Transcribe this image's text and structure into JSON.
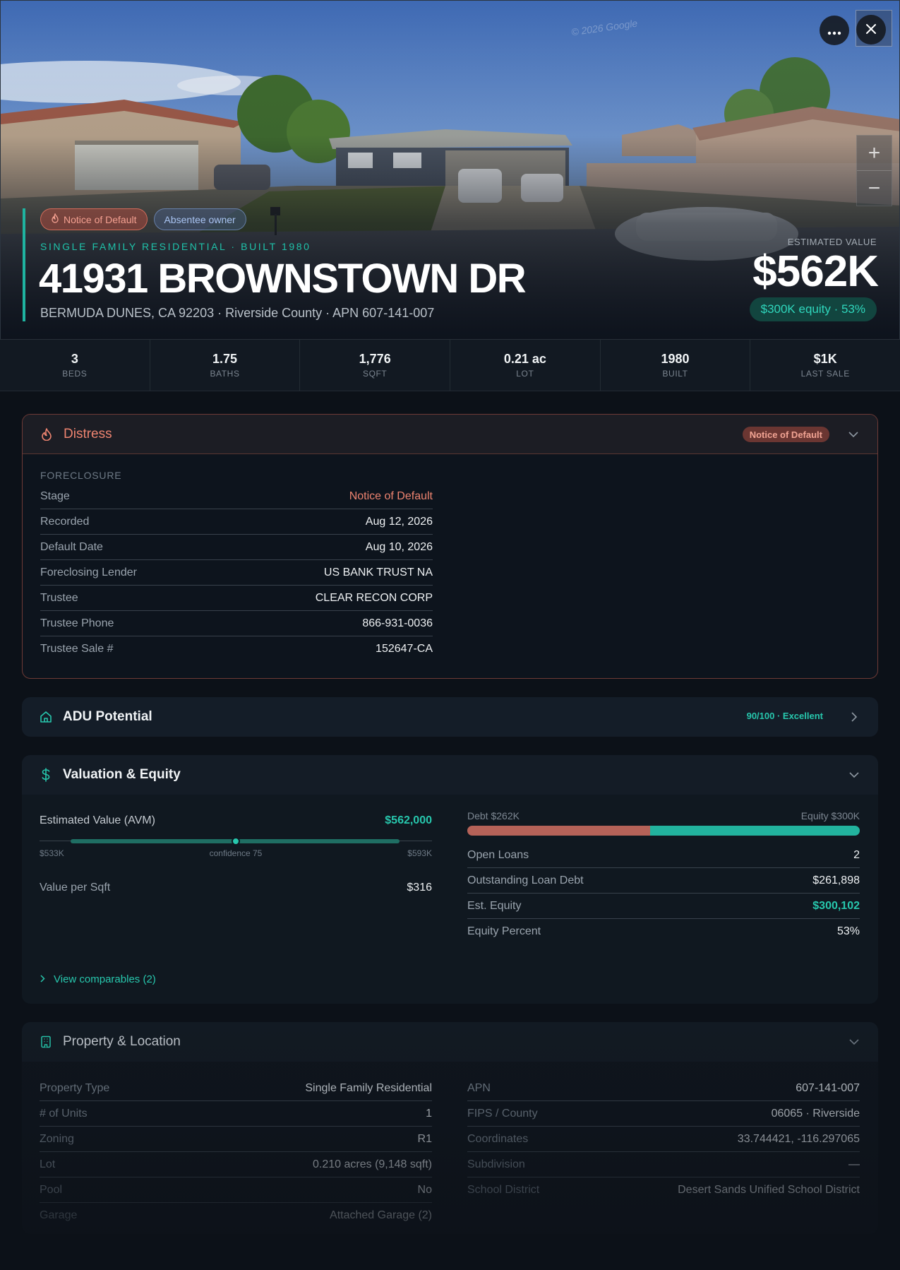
{
  "hero": {
    "watermark": "© 2026 Google",
    "chips": [
      "Notice of Default",
      "Absentee owner"
    ],
    "eyebrow": "SINGLE FAMILY RESIDENTIAL · BUILT 1980",
    "address": "41931 BROWNSTOWN DR",
    "subaddress": "BERMUDA DUNES, CA 92203 · Riverside County · APN 607-141-007",
    "estimated_label": "ESTIMATED VALUE",
    "estimated_value": "$562K",
    "equity_pill": "$300K equity · 53%",
    "zoom_in": "+",
    "zoom_out": "−"
  },
  "stats": [
    {
      "value": "3",
      "label": "BEDS"
    },
    {
      "value": "1.75",
      "label": "BATHS"
    },
    {
      "value": "1,776",
      "label": "SQFT"
    },
    {
      "value": "0.21 ac",
      "label": "LOT"
    },
    {
      "value": "1980",
      "label": "BUILT"
    },
    {
      "value": "$1K",
      "label": "LAST SALE"
    }
  ],
  "distress": {
    "title": "Distress",
    "badge": "Notice of Default",
    "section": "FORECLOSURE",
    "rows": [
      {
        "k": "Stage",
        "v": "Notice of Default"
      },
      {
        "k": "Recorded",
        "v": "Aug 12, 2026"
      },
      {
        "k": "Default Date",
        "v": "Aug 10, 2026"
      },
      {
        "k": "Foreclosing Lender",
        "v": "US BANK TRUST NA"
      },
      {
        "k": "Trustee",
        "v": "CLEAR RECON CORP"
      },
      {
        "k": "Trustee Phone",
        "v": "866-931-0036"
      },
      {
        "k": "Trustee Sale #",
        "v": "152647-CA"
      }
    ]
  },
  "adu": {
    "title": "ADU Potential",
    "score": "90/100 · Excellent"
  },
  "valuation": {
    "title": "Valuation & Equity",
    "avm_label": "Estimated Value (AVM)",
    "avm_value": "$562,000",
    "range_low": "$533K",
    "range_mid": "confidence 75",
    "range_high": "$593K",
    "confidence": 75,
    "value_per_sqft_label": "Value per Sqft",
    "value_per_sqft": "$316",
    "debt_label": "Debt $262K",
    "equity_label": "Equity $300K",
    "debt_share": 0.466,
    "rows": [
      {
        "k": "Open Loans",
        "v": "2"
      },
      {
        "k": "Outstanding Loan Debt",
        "v": "$261,898"
      },
      {
        "k": "Est. Equity",
        "v": "$300,102"
      },
      {
        "k": "Equity Percent",
        "v": "53%"
      }
    ],
    "comparables": "View comparables (2)"
  },
  "property": {
    "title": "Property & Location",
    "left": [
      {
        "k": "Property Type",
        "v": "Single Family Residential"
      },
      {
        "k": "# of Units",
        "v": "1"
      },
      {
        "k": "Zoning",
        "v": "R1"
      },
      {
        "k": "Lot",
        "v": "0.210 acres (9,148 sqft)"
      },
      {
        "k": "Pool",
        "v": "No"
      },
      {
        "k": "Garage",
        "v": "Attached Garage (2)"
      }
    ],
    "right": [
      {
        "k": "APN",
        "v": "607-141-007"
      },
      {
        "k": "FIPS / County",
        "v": "06065 · Riverside"
      },
      {
        "k": "Coordinates",
        "v": "33.744421, -116.297065"
      },
      {
        "k": "Subdivision",
        "v": "—"
      },
      {
        "k": "School District",
        "v": "Desert Sands Unified School District"
      }
    ]
  },
  "colors": {
    "accent": "#27c7ad",
    "distress": "#ee8470",
    "background": "#0c1118"
  }
}
